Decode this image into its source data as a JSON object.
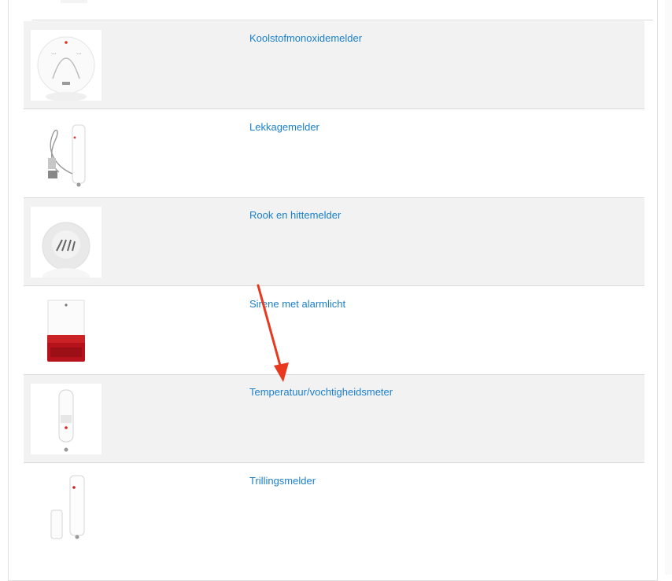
{
  "products": [
    {
      "name": "Koolstofmonoxidemelder",
      "icon": "co-detector-icon"
    },
    {
      "name": "Lekkagemelder",
      "icon": "leak-sensor-icon"
    },
    {
      "name": "Rook en hittemelder",
      "icon": "smoke-detector-icon"
    },
    {
      "name": "Sirene met alarmlicht",
      "icon": "siren-icon"
    },
    {
      "name": "Temperatuur/vochtigheidsmeter",
      "icon": "thermometer-sensor-icon"
    },
    {
      "name": "Trillingsmelder",
      "icon": "vibration-sensor-icon"
    }
  ],
  "colors": {
    "link": "#1a7fcc",
    "row_shade": "#f2f2f2",
    "annotation_arrow": "#e8391f"
  }
}
